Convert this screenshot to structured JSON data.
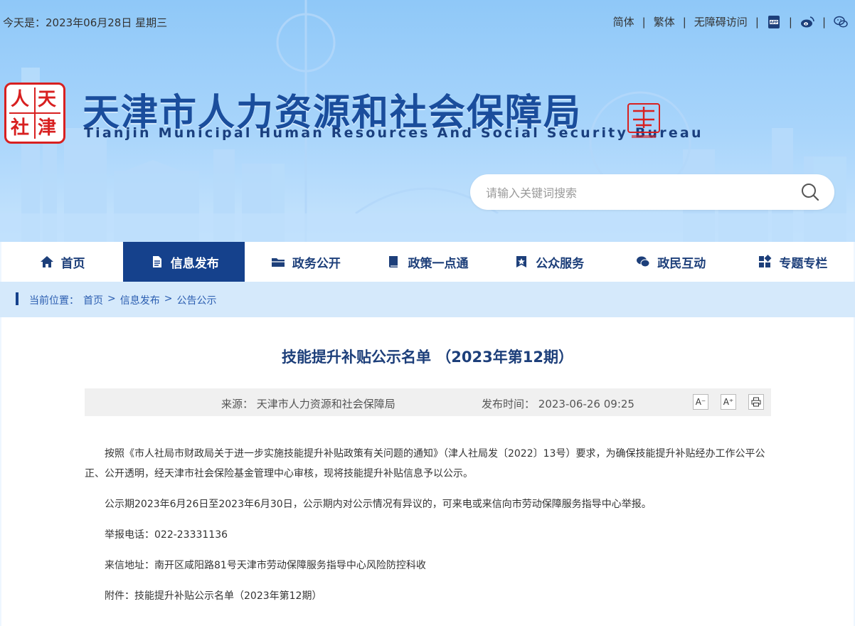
{
  "topbar": {
    "today": "今天是：2023年06月28日 星期三",
    "links": [
      "简体",
      "繁体",
      "无障碍访问"
    ],
    "icons": [
      "app-icon",
      "weibo-icon",
      "wechat-icon"
    ]
  },
  "header": {
    "seal_chars": [
      "人",
      "天",
      "社",
      "津"
    ],
    "title_cn": "天津市人力资源和社会保障局",
    "title_en": "Tianjin Municipal Human Resources And Social Security Bureau"
  },
  "search": {
    "placeholder": "请输入关键词搜索"
  },
  "nav": {
    "items": [
      {
        "label": "首页",
        "icon": "home-icon"
      },
      {
        "label": "信息发布",
        "icon": "document-icon",
        "active": true
      },
      {
        "label": "政务公开",
        "icon": "folder-icon"
      },
      {
        "label": "政策一点通",
        "icon": "book-icon"
      },
      {
        "label": "公众服务",
        "icon": "star-badge-icon"
      },
      {
        "label": "政民互动",
        "icon": "chat-icon"
      },
      {
        "label": "专题专栏",
        "icon": "grid-icon"
      }
    ]
  },
  "breadcrumb": {
    "prefix": "当前位置：",
    "items": [
      "首页",
      "信息发布",
      "公告公示"
    ],
    "separator": ">"
  },
  "article": {
    "title": "技能提升补贴公示名单 （2023年第12期）",
    "source_label": "来源：",
    "source_value": "天津市人力资源和社会保障局",
    "time_label": "发布时间：",
    "time_value": "2023-06-26 09:25",
    "tools": [
      "A⁻",
      "A⁺"
    ],
    "paragraphs": [
      "按照《市人社局市财政局关于进一步实施技能提升补贴政策有关问题的通知》（津人社局发〔2022〕13号）要求，为确保技能提升补贴经办工作公平公正、公开透明，经天津市社会保险基金管理中心审核，现将技能提升补贴信息予以公示。",
      "公示期2023年6月26日至2023年6月30日，公示期内对公示情况有异议的，可来电或来信向市劳动保障服务指导中心举报。",
      "举报电话：022-23331136",
      "来信地址：南开区咸阳路81号天津市劳动保障服务指导中心风险防控科收",
      "附件：技能提升补贴公示名单（2023年第12期）"
    ]
  },
  "colors": {
    "primary": "#15418c",
    "title_blue": "#1a4d9c",
    "seal_red": "#d82020"
  }
}
